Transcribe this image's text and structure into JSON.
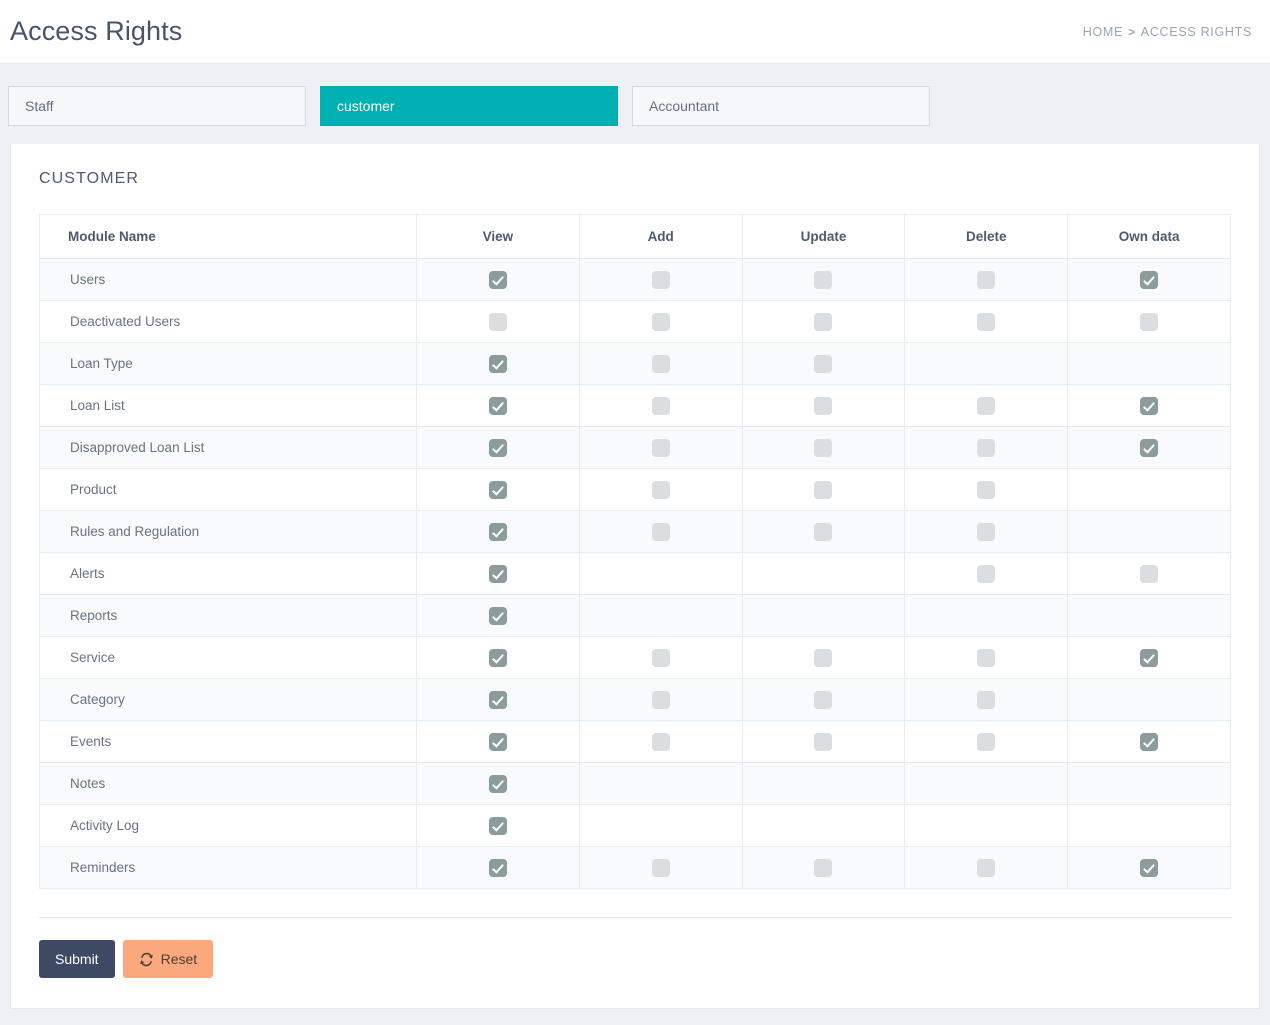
{
  "header": {
    "title": "Access Rights",
    "breadcrumb": {
      "home": "HOME",
      "separator": ">",
      "current": "ACCESS RIGHTS"
    }
  },
  "tabs": [
    {
      "label": "Staff",
      "active": false
    },
    {
      "label": "customer",
      "active": true
    },
    {
      "label": "Accountant",
      "active": false
    }
  ],
  "card": {
    "title": "CUSTOMER"
  },
  "table": {
    "columns": [
      "Module Name",
      "View",
      "Add",
      "Update",
      "Delete",
      "Own data"
    ],
    "rows": [
      {
        "module": "Users",
        "view": "checked",
        "add": "unchecked",
        "update": "unchecked",
        "delete": "unchecked",
        "own": "checked"
      },
      {
        "module": "Deactivated Users",
        "view": "unchecked",
        "add": "unchecked",
        "update": "unchecked",
        "delete": "unchecked",
        "own": "unchecked"
      },
      {
        "module": "Loan Type",
        "view": "checked",
        "add": "unchecked",
        "update": "unchecked",
        "delete": "none",
        "own": "none"
      },
      {
        "module": "Loan List",
        "view": "checked",
        "add": "unchecked",
        "update": "unchecked",
        "delete": "unchecked",
        "own": "checked"
      },
      {
        "module": "Disapproved Loan List",
        "view": "checked",
        "add": "unchecked",
        "update": "unchecked",
        "delete": "unchecked",
        "own": "checked"
      },
      {
        "module": "Product",
        "view": "checked",
        "add": "unchecked",
        "update": "unchecked",
        "delete": "unchecked",
        "own": "none"
      },
      {
        "module": "Rules and Regulation",
        "view": "checked",
        "add": "unchecked",
        "update": "unchecked",
        "delete": "unchecked",
        "own": "none"
      },
      {
        "module": "Alerts",
        "view": "checked",
        "add": "none",
        "update": "none",
        "delete": "unchecked",
        "own": "unchecked"
      },
      {
        "module": "Reports",
        "view": "checked",
        "add": "none",
        "update": "none",
        "delete": "none",
        "own": "none"
      },
      {
        "module": "Service",
        "view": "checked",
        "add": "unchecked",
        "update": "unchecked",
        "delete": "unchecked",
        "own": "checked"
      },
      {
        "module": "Category",
        "view": "checked",
        "add": "unchecked",
        "update": "unchecked",
        "delete": "unchecked",
        "own": "none"
      },
      {
        "module": "Events",
        "view": "checked",
        "add": "unchecked",
        "update": "unchecked",
        "delete": "unchecked",
        "own": "checked"
      },
      {
        "module": "Notes",
        "view": "checked",
        "add": "none",
        "update": "none",
        "delete": "none",
        "own": "none"
      },
      {
        "module": "Activity Log",
        "view": "checked",
        "add": "none",
        "update": "none",
        "delete": "none",
        "own": "none"
      },
      {
        "module": "Reminders",
        "view": "checked",
        "add": "unchecked",
        "update": "unchecked",
        "delete": "unchecked",
        "own": "checked"
      }
    ]
  },
  "actions": {
    "submit_label": "Submit",
    "reset_label": "Reset",
    "reset_icon": "refresh-icon"
  },
  "colors": {
    "accent_teal": "#00b0b2",
    "submit_navy": "#3e4a63",
    "reset_orange": "#fca87e",
    "checkbox_checked": "#8c9c9c",
    "checkbox_unchecked": "#dadee1",
    "page_background": "#eef0f4"
  }
}
